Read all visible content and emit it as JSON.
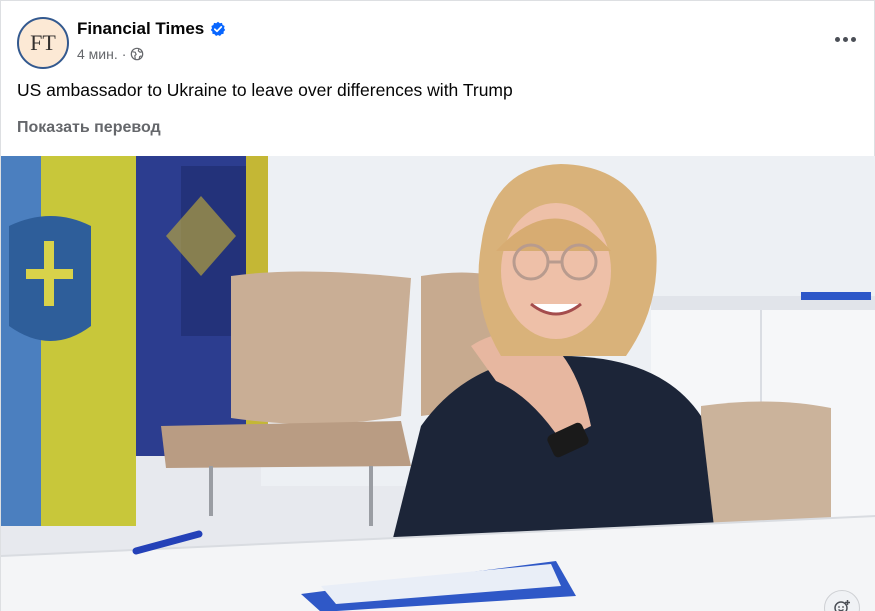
{
  "post": {
    "page_name": "Financial Times",
    "avatar_text": "FT",
    "timestamp": "4 мин.",
    "separator": "·",
    "text": "US ambassador to Ukraine to leave over differences with Trump",
    "translate_link": "Показать перевод",
    "icons": {
      "verified": "verified-badge-icon",
      "audience": "globe-icon",
      "menu": "more-options-icon",
      "reaction": "add-reaction-icon"
    },
    "colors": {
      "verified_blue": "#0866ff",
      "avatar_bg": "#fce9d5",
      "secondary_text": "#65676b"
    }
  }
}
